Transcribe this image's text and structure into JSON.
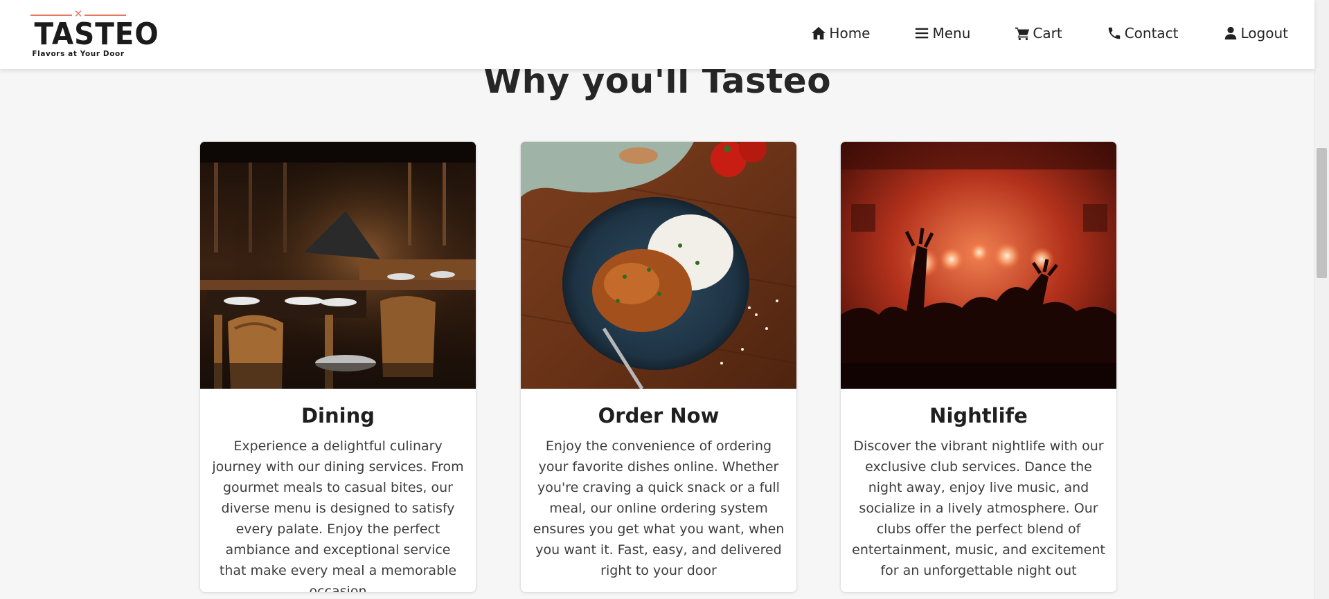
{
  "brand": {
    "name": "TASTEO",
    "tagline": "Flavors at Your Door",
    "accent_color": "#e07a5f"
  },
  "nav": {
    "items": [
      {
        "label": "Home",
        "icon": "home-icon"
      },
      {
        "label": "Menu",
        "icon": "menu-bars-icon"
      },
      {
        "label": "Cart",
        "icon": "cart-icon"
      },
      {
        "label": "Contact",
        "icon": "phone-icon"
      },
      {
        "label": "Logout",
        "icon": "user-icon"
      }
    ]
  },
  "section": {
    "title": "Why you'll Tasteo"
  },
  "cards": [
    {
      "title": "Dining",
      "image": "restaurant-dining-room-photo",
      "text": "Experience a delightful culinary journey with our dining services. From gourmet meals to casual bites, our diverse menu is designed to satisfy every palate. Enjoy the perfect ambiance and exceptional service that make every meal a memorable occasion"
    },
    {
      "title": "Order Now",
      "image": "curry-rice-plate-photo",
      "text": "Enjoy the convenience of ordering your favorite dishes online. Whether you're craving a quick snack or a full meal, our online ordering system ensures you get what you want, when you want it. Fast, easy, and delivered right to your door"
    },
    {
      "title": "Nightlife",
      "image": "nightclub-crowd-photo",
      "text": "Discover the vibrant nightlife with our exclusive club services. Dance the night away, enjoy live music, and socialize in a lively atmosphere. Our clubs offer the perfect blend of entertainment, music, and excitement for an unforgettable night out"
    }
  ]
}
